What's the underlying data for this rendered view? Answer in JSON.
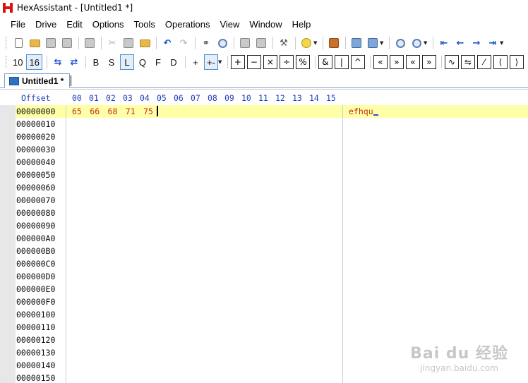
{
  "window": {
    "title": "HexAssistant - [Untitled1 *]"
  },
  "menu": {
    "items": [
      {
        "label": "File"
      },
      {
        "label": "Drive"
      },
      {
        "label": "Edit"
      },
      {
        "label": "Options"
      },
      {
        "label": "Tools"
      },
      {
        "label": "Operations"
      },
      {
        "label": "View"
      },
      {
        "label": "Window"
      },
      {
        "label": "Help"
      }
    ]
  },
  "toolbar2": {
    "base10": "10",
    "base16": "16",
    "size_b": "B",
    "size_s": "S",
    "size_l": "L",
    "size_q": "Q",
    "size_f": "F",
    "size_d": "D",
    "op_plus": "+",
    "op_plusminus": "+-",
    "op_add": "+",
    "op_sub": "−",
    "op_mul": "×",
    "op_div": "÷",
    "op_pct": "%",
    "op_and": "&",
    "op_or": "|",
    "op_xor": "^"
  },
  "tab": {
    "label": "Untitled1 *"
  },
  "editor": {
    "offset_header": "Offset",
    "columns": [
      "00",
      "01",
      "02",
      "03",
      "04",
      "05",
      "06",
      "07",
      "08",
      "09",
      "10",
      "11",
      "12",
      "13",
      "14",
      "15"
    ],
    "rows": [
      {
        "offset": "00000000",
        "bytes": "65 66 68 71 75",
        "ascii": "efhqu"
      },
      {
        "offset": "00000010"
      },
      {
        "offset": "00000020"
      },
      {
        "offset": "00000030"
      },
      {
        "offset": "00000040"
      },
      {
        "offset": "00000050"
      },
      {
        "offset": "00000060"
      },
      {
        "offset": "00000070"
      },
      {
        "offset": "00000080"
      },
      {
        "offset": "00000090"
      },
      {
        "offset": "000000A0"
      },
      {
        "offset": "000000B0"
      },
      {
        "offset": "000000C0"
      },
      {
        "offset": "000000D0"
      },
      {
        "offset": "000000E0"
      },
      {
        "offset": "000000F0"
      },
      {
        "offset": "00000100"
      },
      {
        "offset": "00000110"
      },
      {
        "offset": "00000120"
      },
      {
        "offset": "00000130"
      },
      {
        "offset": "00000140"
      },
      {
        "offset": "00000150"
      }
    ]
  },
  "watermark": {
    "main": "Bai du 经验",
    "sub": "jingyan.baidu.com"
  },
  "colors": {
    "current_row": "#ffffa8",
    "byte_text": "#c02b1a",
    "header_text": "#1f3fbf",
    "gutter": "#e7e7e7"
  }
}
